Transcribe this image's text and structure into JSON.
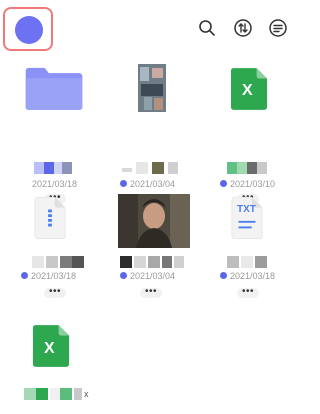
{
  "top_bar": {
    "icons": [
      "search-icon",
      "sort-icon",
      "menu-icon"
    ]
  },
  "files": [
    {
      "type": "folder",
      "date": "2021/03/18",
      "more": "•••"
    },
    {
      "type": "video",
      "date": "2021/03/04",
      "more": "•••"
    },
    {
      "type": "excel",
      "date": "2021/03/10",
      "more": "•••",
      "glyph": "X"
    },
    {
      "type": "archive",
      "date": "2021/03/18",
      "more": "•••"
    },
    {
      "type": "video",
      "date": "2021/03/04",
      "more": "•••"
    },
    {
      "type": "text",
      "date": "2021/03/18",
      "more": "•••",
      "glyph": "TXT"
    },
    {
      "type": "excel",
      "date": "",
      "more": "",
      "glyph": "X",
      "caption_tail": "x"
    }
  ],
  "colors": {
    "accent": "#5b67e8",
    "folder": "#8a93f5",
    "excel": "#2ea84f",
    "frame": "#f07a7a"
  }
}
